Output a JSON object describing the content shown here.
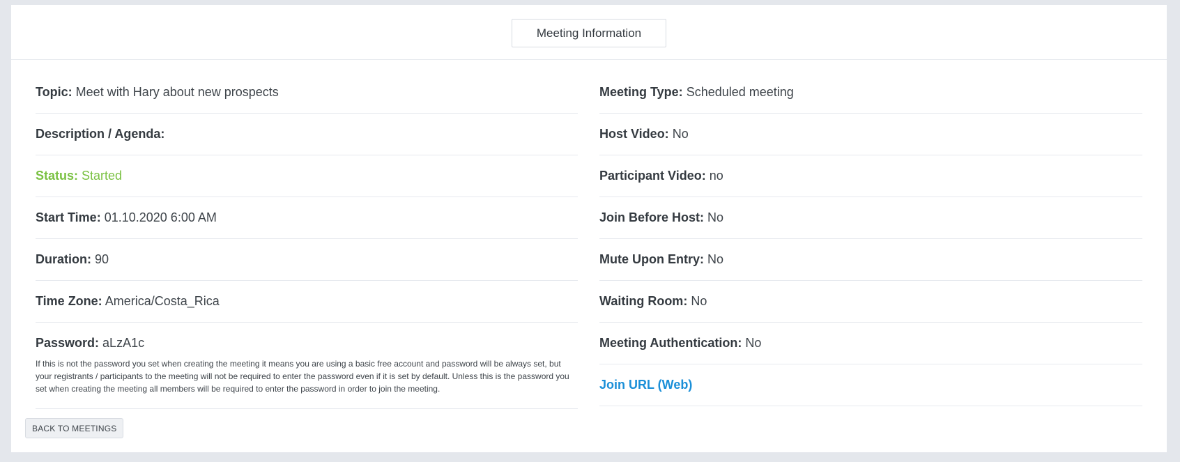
{
  "header": {
    "tab_label": "Meeting Information"
  },
  "left": [
    {
      "label": "Topic:",
      "value": "Meet with Hary about new prospects"
    },
    {
      "label": "Description / Agenda:",
      "value": ""
    },
    {
      "label": "Status:",
      "value": "Started"
    },
    {
      "label": "Start Time:",
      "value": "01.10.2020 6:00 AM"
    },
    {
      "label": "Duration:",
      "value": "90"
    },
    {
      "label": "Time Zone:",
      "value": "America/Costa_Rica"
    },
    {
      "label": "Password:",
      "value": "aLzA1c"
    }
  ],
  "password_note": "If this is not the password you set when creating the meeting it means you are using a basic free account and password will be always set, but your registrants / participants to the meeting will not be required to enter the password even if it is set by default. Unless this is the password you set when creating the meeting all members will be required to enter the password in order to join the meeting.",
  "right": [
    {
      "label": "Meeting Type:",
      "value": "Scheduled meeting"
    },
    {
      "label": "Host Video:",
      "value": "No"
    },
    {
      "label": "Participant Video:",
      "value": "no"
    },
    {
      "label": "Join Before Host:",
      "value": "No"
    },
    {
      "label": "Mute Upon Entry:",
      "value": "No"
    },
    {
      "label": "Waiting Room:",
      "value": "No"
    },
    {
      "label": "Meeting Authentication:",
      "value": "No"
    }
  ],
  "join_link_label": "Join URL (Web)",
  "back_button_label": "BACK TO MEETINGS",
  "colors": {
    "status": "#7ac142",
    "link": "#1a8fd8"
  }
}
